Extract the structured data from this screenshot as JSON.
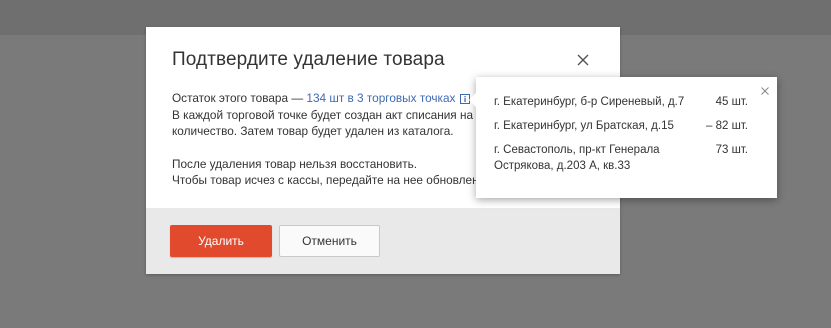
{
  "modal": {
    "title": "Подтвердите удаление товара",
    "body": {
      "remaining_prefix": "Остаток этого товара — ",
      "remaining_link": "134 шт в 3 торговых точках",
      "line2": "В каждой торговой точке будет создан акт списания на с",
      "line3": "количество. Затем товар будет удален из каталога.",
      "line4": "После удаления товар нельзя восстановить.",
      "line5": "Чтобы товар исчез с кассы, передайте на нее обновленн"
    },
    "buttons": {
      "delete": "Удалить",
      "cancel": "Отменить"
    }
  },
  "popover": {
    "rows": [
      {
        "address": "г. Екатеринбург, б-р Сиреневый, д.7",
        "qty": "45 шт."
      },
      {
        "address": "г. Екатеринбург, ул Братская, д.15",
        "qty": "– 82 шт."
      },
      {
        "address": "г. Севастополь, пр-кт Генерала Острякова, д.203 А, кв.33",
        "qty": "73 шт."
      }
    ]
  },
  "colors": {
    "backdrop": "#7a7a7a",
    "accent_button": "#e24a2e",
    "link": "#3e6ab3",
    "footer": "#e9e9e9"
  },
  "icons": {
    "modal_close": "close-icon",
    "info": "info-icon",
    "popover_close": "close-icon"
  }
}
